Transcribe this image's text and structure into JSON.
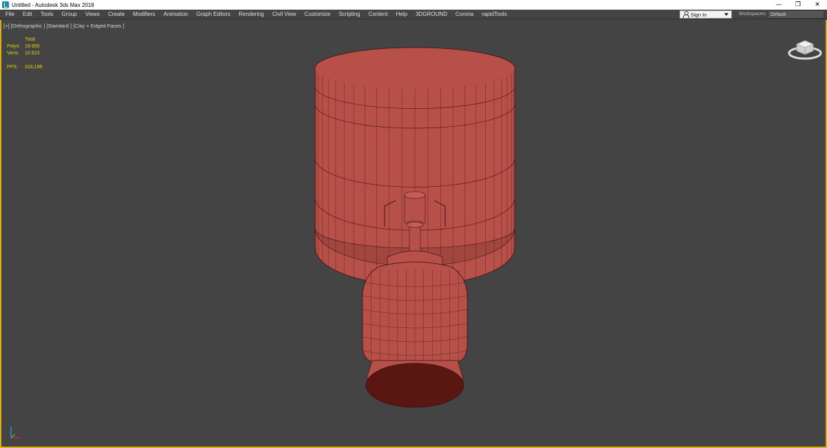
{
  "window": {
    "title": "Untitled - Autodesk 3ds Max 2018",
    "minimize": "—",
    "restore": "❐",
    "close": "✕"
  },
  "menu": {
    "items": [
      "File",
      "Edit",
      "Tools",
      "Group",
      "Views",
      "Create",
      "Modifiers",
      "Animation",
      "Graph Editors",
      "Rendering",
      "Civil View",
      "Customize",
      "Scripting",
      "Content",
      "Help",
      "3DGROUND",
      "Corona",
      "rapidTools"
    ],
    "signin_label": "Sign In",
    "workspaces_label": "Workspaces:",
    "workspace_value": "Default"
  },
  "viewport": {
    "label": "[+] [Orthographic ] [Standard ] [Clay + Edged Faces ]",
    "stats": {
      "total_label": "Total",
      "polys_label": "Polys:",
      "polys_value": "19 850",
      "verts_label": "Verts:",
      "verts_value": "10 623",
      "fps_label": "FPS:",
      "fps_value": "318,198"
    }
  },
  "colors": {
    "viewport_bg": "#444444",
    "active_border": "#e0b010",
    "stats_text": "#e6d200",
    "clay": "#b8504a",
    "wire": "#3a1210"
  },
  "icons": [
    "app-icon",
    "user-icon",
    "dropdown-arrow-icon",
    "viewcube-icon",
    "axis-tripod-icon"
  ]
}
